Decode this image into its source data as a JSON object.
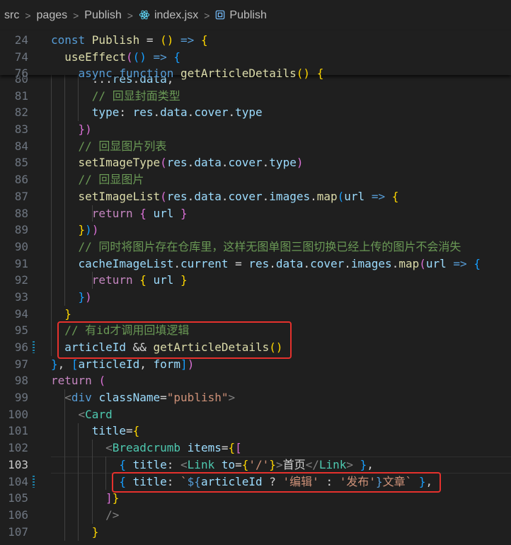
{
  "breadcrumb": {
    "items": [
      "src",
      "pages",
      "Publish",
      "index.jsx",
      "Publish"
    ],
    "separator": ">"
  },
  "sticky_lines": [
    {
      "number": "24",
      "segments": [
        [
          "k",
          "const "
        ],
        [
          "f",
          "Publish "
        ],
        [
          "w",
          "= "
        ],
        [
          "y",
          "() "
        ],
        [
          "k",
          "=> "
        ],
        [
          "y",
          "{"
        ]
      ]
    },
    {
      "number": "74",
      "segments": [
        [
          "w",
          "  "
        ],
        [
          "f",
          "useEffect"
        ],
        [
          "p",
          "("
        ],
        [
          "b",
          "() "
        ],
        [
          "k",
          "=> "
        ],
        [
          "b",
          "{"
        ]
      ]
    },
    {
      "number": "76",
      "segments": [
        [
          "w",
          "    "
        ],
        [
          "k",
          "async function "
        ],
        [
          "f",
          "getArticleDetails"
        ],
        [
          "y",
          "() {"
        ]
      ]
    }
  ],
  "code_lines": [
    {
      "number": "80",
      "segments": [
        [
          "w",
          "      ..."
        ],
        [
          "v",
          "res"
        ],
        [
          "w",
          "."
        ],
        [
          "v",
          "data"
        ],
        [
          "w",
          ","
        ]
      ]
    },
    {
      "number": "81",
      "segments": [
        [
          "g",
          "      // 回显封面类型"
        ]
      ]
    },
    {
      "number": "82",
      "segments": [
        [
          "w",
          "      "
        ],
        [
          "v",
          "type"
        ],
        [
          "w",
          ": "
        ],
        [
          "v",
          "res"
        ],
        [
          "w",
          "."
        ],
        [
          "v",
          "data"
        ],
        [
          "w",
          "."
        ],
        [
          "v",
          "cover"
        ],
        [
          "w",
          "."
        ],
        [
          "v",
          "type"
        ]
      ]
    },
    {
      "number": "83",
      "segments": [
        [
          "w",
          "    "
        ],
        [
          "p",
          "})"
        ]
      ]
    },
    {
      "number": "84",
      "segments": [
        [
          "g",
          "    // 回显图片列表"
        ]
      ]
    },
    {
      "number": "85",
      "segments": [
        [
          "w",
          "    "
        ],
        [
          "f",
          "setImageType"
        ],
        [
          "p",
          "("
        ],
        [
          "v",
          "res"
        ],
        [
          "w",
          "."
        ],
        [
          "v",
          "data"
        ],
        [
          "w",
          "."
        ],
        [
          "v",
          "cover"
        ],
        [
          "w",
          "."
        ],
        [
          "v",
          "type"
        ],
        [
          "p",
          ")"
        ]
      ]
    },
    {
      "number": "86",
      "segments": [
        [
          "g",
          "    // 回显图片"
        ]
      ]
    },
    {
      "number": "87",
      "segments": [
        [
          "w",
          "    "
        ],
        [
          "f",
          "setImageList"
        ],
        [
          "p",
          "("
        ],
        [
          "v",
          "res"
        ],
        [
          "w",
          "."
        ],
        [
          "v",
          "data"
        ],
        [
          "w",
          "."
        ],
        [
          "v",
          "cover"
        ],
        [
          "w",
          "."
        ],
        [
          "v",
          "images"
        ],
        [
          "w",
          "."
        ],
        [
          "f",
          "map"
        ],
        [
          "b",
          "("
        ],
        [
          "v",
          "url "
        ],
        [
          "k",
          "=> "
        ],
        [
          "y",
          "{"
        ]
      ]
    },
    {
      "number": "88",
      "segments": [
        [
          "w",
          "      "
        ],
        [
          "c",
          "return "
        ],
        [
          "p",
          "{ "
        ],
        [
          "v",
          "url "
        ],
        [
          "p",
          "}"
        ]
      ]
    },
    {
      "number": "89",
      "segments": [
        [
          "w",
          "    "
        ],
        [
          "y",
          "}"
        ],
        [
          "b",
          ")"
        ],
        [
          "p",
          ")"
        ]
      ]
    },
    {
      "number": "90",
      "segments": [
        [
          "g",
          "    // 同时将图片存在仓库里，这样无图单图三图切换已经上传的图片不会消失"
        ]
      ]
    },
    {
      "number": "91",
      "segments": [
        [
          "w",
          "    "
        ],
        [
          "v",
          "cacheImageList"
        ],
        [
          "w",
          "."
        ],
        [
          "v",
          "current "
        ],
        [
          "w",
          "= "
        ],
        [
          "v",
          "res"
        ],
        [
          "w",
          "."
        ],
        [
          "v",
          "data"
        ],
        [
          "w",
          "."
        ],
        [
          "v",
          "cover"
        ],
        [
          "w",
          "."
        ],
        [
          "v",
          "images"
        ],
        [
          "w",
          "."
        ],
        [
          "f",
          "map"
        ],
        [
          "p",
          "("
        ],
        [
          "v",
          "url "
        ],
        [
          "k",
          "=> "
        ],
        [
          "b",
          "{"
        ]
      ]
    },
    {
      "number": "92",
      "segments": [
        [
          "w",
          "      "
        ],
        [
          "c",
          "return "
        ],
        [
          "y",
          "{ "
        ],
        [
          "v",
          "url "
        ],
        [
          "y",
          "}"
        ]
      ]
    },
    {
      "number": "93",
      "segments": [
        [
          "w",
          "    "
        ],
        [
          "b",
          "}"
        ],
        [
          "p",
          ")"
        ]
      ]
    },
    {
      "number": "94",
      "segments": [
        [
          "w",
          "  "
        ],
        [
          "y",
          "}"
        ]
      ]
    },
    {
      "number": "95",
      "segments": [
        [
          "g",
          "  // 有id才调用回填逻辑"
        ]
      ]
    },
    {
      "number": "96",
      "segments": [
        [
          "w",
          "  "
        ],
        [
          "v",
          "articleId "
        ],
        [
          "w",
          "&& "
        ],
        [
          "f",
          "getArticleDetails"
        ],
        [
          "y",
          "()"
        ]
      ]
    },
    {
      "number": "97",
      "segments": [
        [
          "b",
          "}"
        ],
        [
          "w",
          ", "
        ],
        [
          "b",
          "["
        ],
        [
          "v",
          "articleId"
        ],
        [
          "w",
          ", "
        ],
        [
          "v",
          "form"
        ],
        [
          "b",
          "]"
        ],
        [
          "p",
          ")"
        ]
      ]
    },
    {
      "number": "98",
      "segments": [
        [
          "c",
          "return "
        ],
        [
          "p",
          "("
        ]
      ]
    },
    {
      "number": "99",
      "segments": [
        [
          "w",
          "  "
        ],
        [
          "gr",
          "<"
        ],
        [
          "k",
          "div "
        ],
        [
          "v",
          "className"
        ],
        [
          "w",
          "="
        ],
        [
          "s",
          "\"publish\""
        ],
        [
          "gr",
          ">"
        ]
      ]
    },
    {
      "number": "100",
      "segments": [
        [
          "w",
          "    "
        ],
        [
          "gr",
          "<"
        ],
        [
          "t",
          "Card"
        ]
      ]
    },
    {
      "number": "101",
      "segments": [
        [
          "w",
          "      "
        ],
        [
          "v",
          "title"
        ],
        [
          "w",
          "="
        ],
        [
          "y",
          "{"
        ]
      ]
    },
    {
      "number": "102",
      "segments": [
        [
          "w",
          "        "
        ],
        [
          "gr",
          "<"
        ],
        [
          "t",
          "Breadcrumb "
        ],
        [
          "v",
          "items"
        ],
        [
          "w",
          "="
        ],
        [
          "y",
          "{"
        ],
        [
          "p",
          "["
        ]
      ]
    },
    {
      "number": "103",
      "segments": [
        [
          "w",
          "          "
        ],
        [
          "b",
          "{ "
        ],
        [
          "v",
          "title"
        ],
        [
          "w",
          ": "
        ],
        [
          "gr",
          "<"
        ],
        [
          "t",
          "Link "
        ],
        [
          "v",
          "to"
        ],
        [
          "w",
          "="
        ],
        [
          "y",
          "{"
        ],
        [
          "s",
          "'/'"
        ],
        [
          "y",
          "}"
        ],
        [
          "gr",
          ">"
        ],
        [
          "w",
          "首页"
        ],
        [
          "gr",
          "</"
        ],
        [
          "t",
          "Link"
        ],
        [
          "gr",
          "> "
        ],
        [
          "b",
          "}"
        ],
        [
          "w",
          ","
        ]
      ]
    },
    {
      "number": "104",
      "segments": [
        [
          "w",
          "          "
        ],
        [
          "b",
          "{ "
        ],
        [
          "v",
          "title"
        ],
        [
          "w",
          ": "
        ],
        [
          "s",
          "`"
        ],
        [
          "k",
          "${"
        ],
        [
          "v",
          "articleId "
        ],
        [
          "w",
          "? "
        ],
        [
          "s",
          "'编辑' "
        ],
        [
          "w",
          ": "
        ],
        [
          "s",
          "'发布'"
        ],
        [
          "k",
          "}"
        ],
        [
          "s",
          "文章` "
        ],
        [
          "b",
          "}"
        ],
        [
          "w",
          ","
        ]
      ]
    },
    {
      "number": "105",
      "segments": [
        [
          "w",
          "        "
        ],
        [
          "p",
          "]"
        ],
        [
          "y",
          "}"
        ]
      ]
    },
    {
      "number": "106",
      "segments": [
        [
          "w",
          "        "
        ],
        [
          "gr",
          "/>"
        ]
      ]
    },
    {
      "number": "107",
      "segments": [
        [
          "w",
          "      "
        ],
        [
          "y",
          "}"
        ]
      ]
    }
  ],
  "active_line": "103",
  "modified_lines": [
    "96",
    "104"
  ],
  "highlights": [
    {
      "lines": [
        "95",
        "96"
      ],
      "color": "#e5312d"
    },
    {
      "lines": [
        "104"
      ],
      "color": "#e5312d"
    }
  ]
}
